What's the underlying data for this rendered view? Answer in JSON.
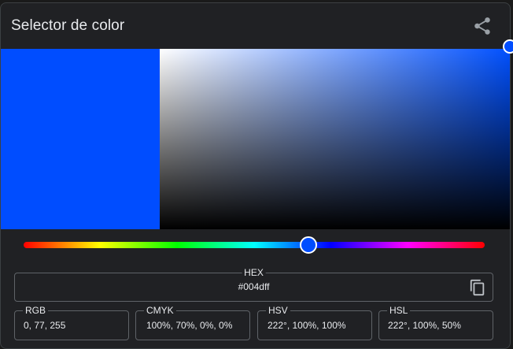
{
  "title": "Selector de color",
  "color": {
    "current": "#004dff",
    "hue_fraction": 0.617
  },
  "hex": {
    "label": "HEX",
    "value": "#004dff"
  },
  "formats": [
    {
      "label": "RGB",
      "value": "0, 77, 255"
    },
    {
      "label": "CMYK",
      "value": "100%, 70%, 0%, 0%"
    },
    {
      "label": "HSV",
      "value": "222°, 100%, 100%"
    },
    {
      "label": "HSL",
      "value": "222°, 100%, 50%"
    }
  ],
  "icons": {
    "share": "share-icon",
    "copy": "copy-icon"
  },
  "colors": {
    "sv_hue_base": "#0050ff",
    "handle_fill": "#004dff"
  }
}
